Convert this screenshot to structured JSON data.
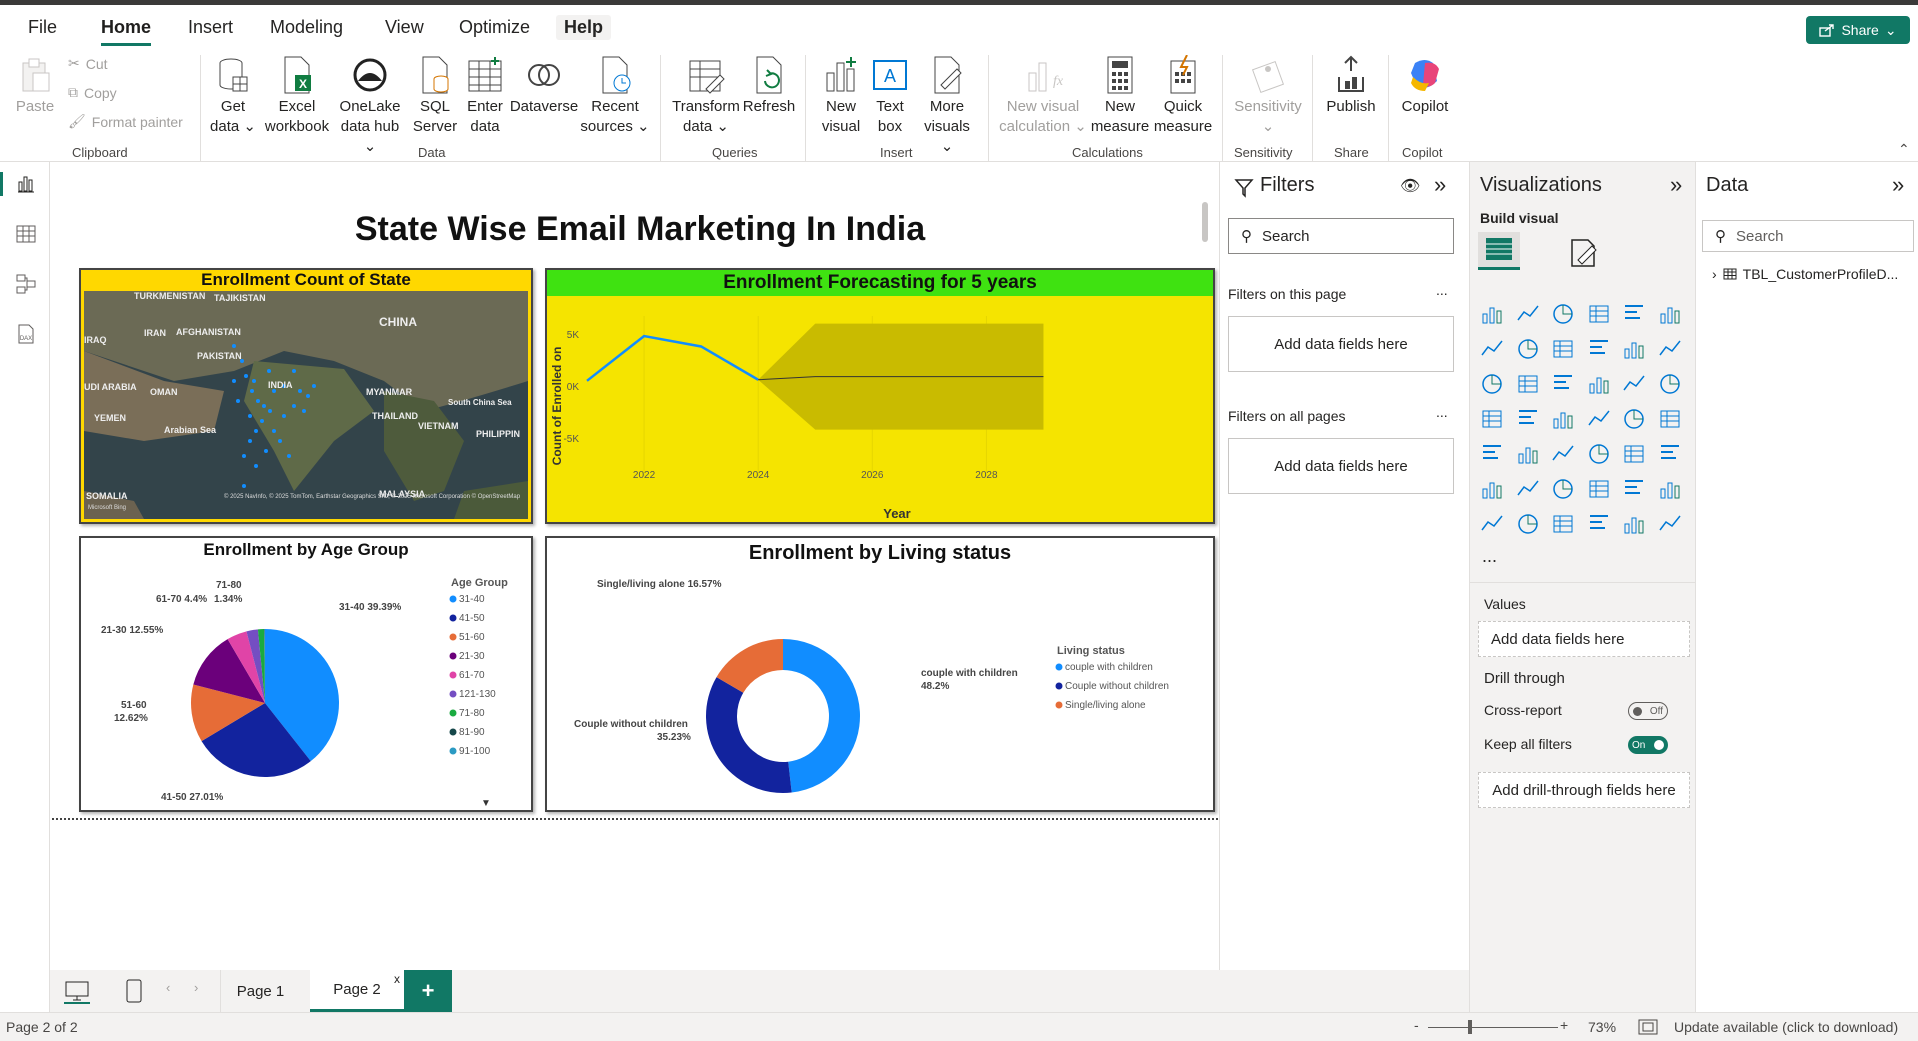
{
  "menu": {
    "items": [
      "File",
      "Home",
      "Insert",
      "Modeling",
      "View",
      "Optimize",
      "Help"
    ],
    "share_label": "Share"
  },
  "ribbon": {
    "clipboard": {
      "paste": "Paste",
      "cut": "Cut",
      "copy": "Copy",
      "format_painter": "Format painter",
      "group": "Clipboard"
    },
    "data": {
      "get_data": "Get data",
      "excel": "Excel workbook",
      "onelake": "OneLake data hub",
      "sql": "SQL Server",
      "enter": "Enter data",
      "dataverse": "Dataverse",
      "recent": "Recent sources",
      "group": "Data"
    },
    "queries": {
      "transform": "Transform data",
      "refresh": "Refresh",
      "group": "Queries"
    },
    "insert": {
      "new_visual": "New visual",
      "text_box": "Text box",
      "more_visuals": "More visuals",
      "group": "Insert"
    },
    "calculations": {
      "new_visual_calc": "New visual calculation",
      "new_measure": "New measure",
      "quick_measure": "Quick measure",
      "group": "Calculations"
    },
    "sensitivity": {
      "label": "Sensitivity",
      "group": "Sensitivity"
    },
    "share": {
      "publish": "Publish",
      "group": "Share"
    },
    "copilot": {
      "label": "Copilot",
      "group": "Copilot"
    }
  },
  "report": {
    "title": "State Wise Email Marketing In India",
    "map": {
      "title": "Enrollment Count of State",
      "labels": [
        "TURKMENISTAN",
        "TAJIKISTAN",
        "CHINA",
        "IRAN",
        "AFGHANISTAN",
        "PAKISTAN",
        "IRAQ",
        "UDI ARABIA",
        "OMAN",
        "INDIA",
        "MYANMAR",
        "South China Sea",
        "YEMEN",
        "Arabian Sea",
        "THAILAND",
        "VIETNAM",
        "PHILIPPIN",
        "SOMALIA",
        "MALAYSIA"
      ],
      "attribution": "© 2025 NavInfo, © 2025 TomTom, Earthstar Geographics SIO, © 2025 Microsoft Corporation © OpenStreetMap",
      "bing": "Microsoft Bing"
    },
    "forecast": {
      "title": "Enrollment Forecasting for 5 years",
      "ylabel": "Count of Enrolled on",
      "xlabel": "Year",
      "yticks": [
        "5K",
        "0K",
        "-5K"
      ],
      "xticks": [
        "2022",
        "2024",
        "2026",
        "2028"
      ]
    },
    "age": {
      "title": "Enrollment by Age Group",
      "legend_title": "Age Group",
      "labels": [
        "31-40 39.39%",
        "41-50 27.01%",
        "51-60",
        "12.62%",
        "21-30 12.55%",
        "61-70 4.4%",
        "1.34%",
        "71-80"
      ]
    },
    "living": {
      "title": "Enrollment by Living status",
      "legend_title": "Living status",
      "labels": [
        "Single/living alone 16.57%",
        "couple with children",
        "48.2%",
        "Couple without children",
        "35.23%"
      ]
    }
  },
  "chart_data": [
    {
      "type": "line",
      "title": "Enrollment Forecasting for 5 years",
      "xlabel": "Year",
      "ylabel": "Count of Enrolled on",
      "ylim": [
        -5000,
        5000
      ],
      "x": [
        2021,
        2022,
        2023,
        2024
      ],
      "series": [
        {
          "values": [
            500,
            4800,
            3800,
            600
          ]
        }
      ],
      "forecast": {
        "x": [
          2024,
          2025,
          2026,
          2027,
          2028,
          2029
        ],
        "values": [
          600,
          900,
          900,
          900,
          900,
          900
        ],
        "upper": [
          600,
          6000,
          6000,
          6000,
          6000,
          6000
        ],
        "lower": [
          600,
          -4200,
          -4200,
          -4200,
          -4200,
          -4200
        ]
      }
    },
    {
      "type": "pie",
      "title": "Enrollment by Age Group",
      "categories": [
        "31-40",
        "41-50",
        "51-60",
        "21-30",
        "61-70",
        "121-130",
        "71-80",
        "81-90",
        "91-100"
      ],
      "values": [
        39.39,
        27.01,
        12.62,
        12.55,
        4.4,
        2.5,
        1.34,
        0.1,
        0.09
      ],
      "colors": [
        "#118dff",
        "#12239e",
        "#e66c37",
        "#6b007b",
        "#e044a7",
        "#744ec2",
        "#1aab40",
        "#15474a",
        "#2b9ac3"
      ]
    },
    {
      "type": "pie",
      "title": "Enrollment by Living status",
      "categories": [
        "couple with children",
        "Couple without children",
        "Single/living alone"
      ],
      "values": [
        48.2,
        35.23,
        16.57
      ],
      "colors": [
        "#118dff",
        "#12239e",
        "#e66c37"
      ]
    }
  ],
  "filters": {
    "title": "Filters",
    "search_placeholder": "Search",
    "on_page": "Filters on this page",
    "on_all": "Filters on all pages",
    "add_fields": "Add data fields here",
    "more": "..."
  },
  "viz": {
    "title": "Visualizations",
    "build": "Build visual",
    "values": "Values",
    "add_fields": "Add data fields here",
    "drill_through": "Drill through",
    "cross_report": "Cross-report",
    "cross_state": "Off",
    "keep_filters": "Keep all filters",
    "keep_state": "On",
    "add_drill": "Add drill-through fields here",
    "more": "..."
  },
  "data_pane": {
    "title": "Data",
    "search_placeholder": "Search",
    "table": "TBL_CustomerProfileD..."
  },
  "pages": {
    "tabs": [
      "Page 1",
      "Page 2"
    ],
    "active": "Page 2",
    "close": "x",
    "add": "+"
  },
  "status": {
    "page": "Page 2 of 2",
    "zoom": "73%",
    "update": "Update available (click to download)",
    "minus": "-",
    "plus": "+"
  }
}
